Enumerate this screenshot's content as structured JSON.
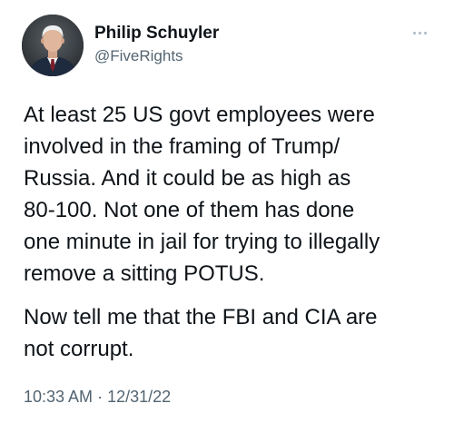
{
  "author": {
    "name": "Philip Schuyler",
    "handle": "@FiveRights"
  },
  "tweet": {
    "paragraph_1_lines": [
      "At least 25 US govt employees were",
      "involved in the framing of Trump/",
      "Russia. And it could be as high as",
      "80-100. Not one of them has done",
      "one minute in jail for trying to illegally",
      "remove a sitting POTUS."
    ],
    "paragraph_2_lines": [
      "Now tell me that the FBI and CIA are",
      "not corrupt."
    ],
    "time": "10:33 AM",
    "separator": "·",
    "date": "12/31/22"
  },
  "icons": {
    "more": "more-horizontal-icon",
    "avatar": "profile-photo"
  }
}
